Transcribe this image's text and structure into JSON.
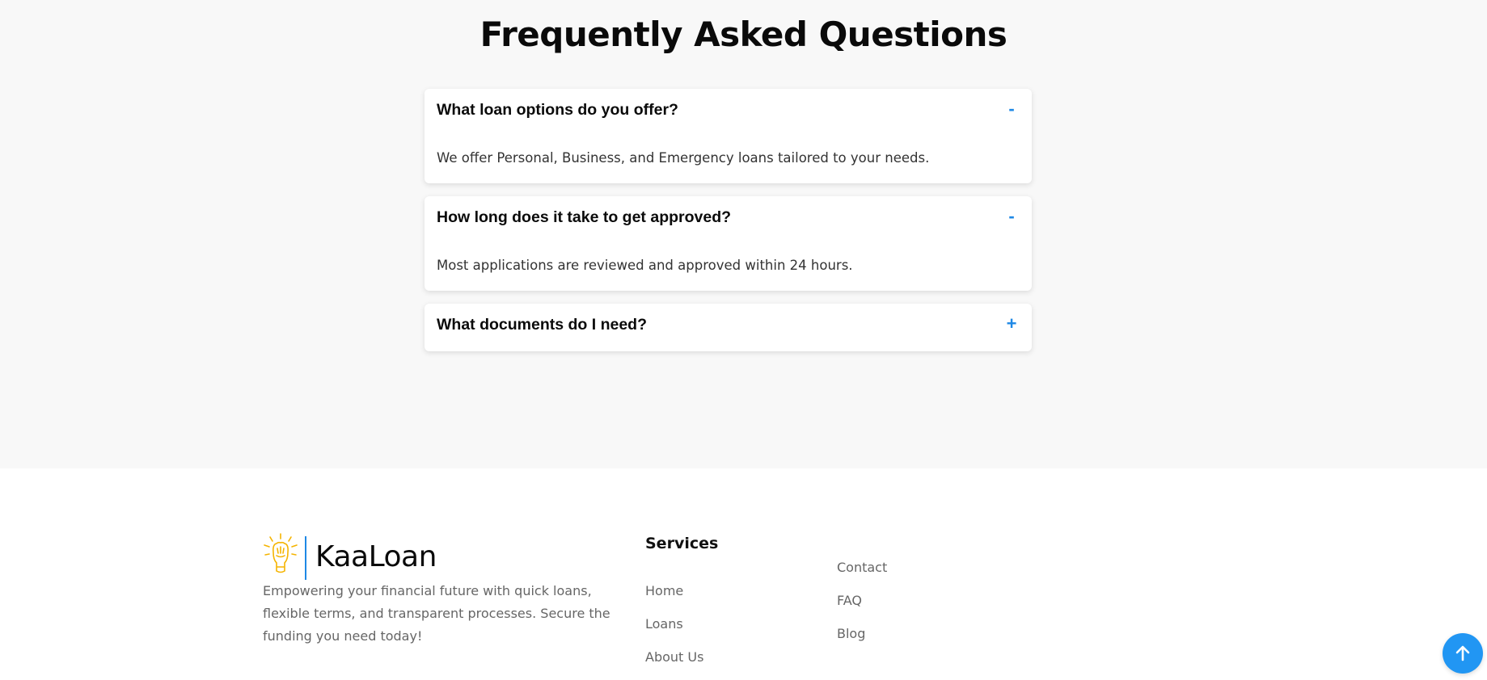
{
  "faq": {
    "title": "Frequently Asked Questions",
    "items": [
      {
        "question": "What loan options do you offer?",
        "answer": "We offer Personal, Business, and Emergency loans tailored to your needs.",
        "toggle": "-"
      },
      {
        "question": "How long does it take to get approved?",
        "answer": "Most applications are reviewed and approved within 24 hours.",
        "toggle": "-"
      },
      {
        "question": "What documents do I need?",
        "answer": "",
        "toggle": "+"
      }
    ]
  },
  "footer": {
    "brand": "KaaLoan",
    "description": "Empowering your financial future with quick loans, flexible terms, and transparent processes. Secure the funding you need today!",
    "services_heading": "Services",
    "links_col1": [
      "Home",
      "Loans",
      "About Us"
    ],
    "links_col2": [
      "Contact",
      "FAQ",
      "Blog"
    ]
  },
  "icons": {
    "logo": "raised-fist-lightbulb-icon",
    "back_to_top": "arrow-up-icon"
  },
  "colors": {
    "accent": "#1e88e5",
    "back_to_top_bg": "#2196f3",
    "logo_yellow": "#f5b400",
    "faq_bg": "#f8f8f8"
  }
}
